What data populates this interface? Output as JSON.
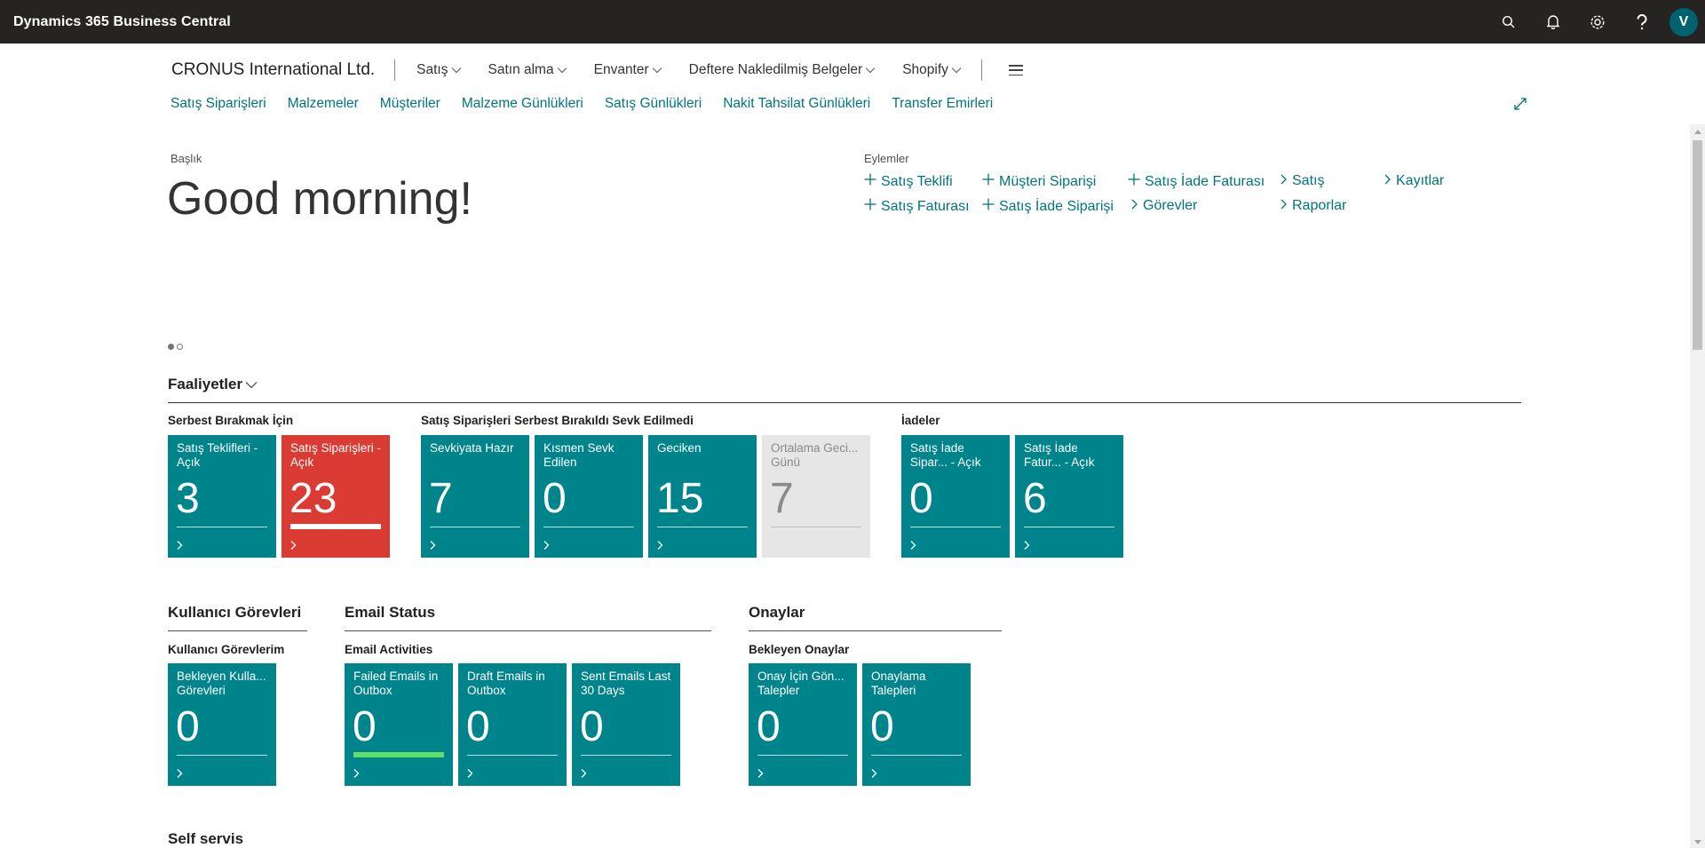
{
  "app": {
    "title": "Dynamics 365 Business Central",
    "user_initial": "V"
  },
  "topbar_icons": [
    "search-icon",
    "bell-icon",
    "gear-icon",
    "help-icon"
  ],
  "nav": {
    "company": "CRONUS International Ltd.",
    "menus": [
      "Satış",
      "Satın alma",
      "Envanter",
      "Deftere Nakledilmiş Belgeler",
      "Shopify"
    ],
    "links": [
      "Satış Siparişleri",
      "Malzemeler",
      "Müşteriler",
      "Malzeme Günlükleri",
      "Satış Günlükleri",
      "Nakit Tahsilat Günlükleri",
      "Transfer Emirleri"
    ]
  },
  "headline": {
    "label": "Başlık",
    "greeting": "Good morning!"
  },
  "actions": {
    "label": "Eylemler",
    "items": [
      {
        "label": "Satış Teklifi",
        "icon": "plus-icon"
      },
      {
        "label": "Satış Faturası",
        "icon": "plus-icon"
      },
      {
        "label": "Müşteri Siparişi",
        "icon": "plus-icon"
      },
      {
        "label": "Satış İade Siparişi",
        "icon": "plus-icon"
      },
      {
        "label": "Satış İade Faturası",
        "icon": "plus-icon"
      },
      {
        "label": "Görevler",
        "icon": "chevron-right-icon"
      },
      {
        "label": "Satış",
        "icon": "chevron-right-icon"
      },
      {
        "label": "Raporlar",
        "icon": "chevron-right-icon"
      },
      {
        "label": "Kayıtlar",
        "icon": "chevron-right-icon"
      }
    ]
  },
  "activities": {
    "title": "Faaliyetler",
    "groups": [
      {
        "title": "Serbest Bırakmak İçin"
      },
      {
        "title": "Satış Siparişleri Serbest Bırakıldı Sevk Edilmedi"
      },
      {
        "title": "İadeler"
      }
    ],
    "tiles": [
      {
        "label": "Satış Teklifleri - Açık",
        "value": "3"
      },
      {
        "label": "Satış Siparişleri - Açık",
        "value": "23"
      },
      {
        "label": "Sevkiyata Hazır",
        "value": "7"
      },
      {
        "label": "Kısmen Sevk Edilen",
        "value": "0"
      },
      {
        "label": "Geciken",
        "value": "15"
      },
      {
        "label": "Ortalama Geci... Günü",
        "value": "7"
      },
      {
        "label": "Satış İade Sipar... - Açık",
        "value": "0"
      },
      {
        "label": "Satış İade Fatur... - Açık",
        "value": "6"
      }
    ]
  },
  "user_tasks": {
    "title": "Kullanıcı Görevleri",
    "group": "Kullanıcı Görevlerim",
    "tiles": [
      {
        "label": "Bekleyen Kulla... Görevleri",
        "value": "0"
      }
    ]
  },
  "email_status": {
    "title": "Email Status",
    "group": "Email Activities",
    "tiles": [
      {
        "label": "Failed Emails in Outbox",
        "value": "0"
      },
      {
        "label": "Draft Emails in Outbox",
        "value": "0"
      },
      {
        "label": "Sent Emails Last 30 Days",
        "value": "0"
      }
    ]
  },
  "approvals": {
    "title": "Onaylar",
    "group": "Bekleyen Onaylar",
    "tiles": [
      {
        "label": "Onay İçin Gön... Talepler",
        "value": "0"
      },
      {
        "label": "Onaylama Talepleri",
        "value": "0"
      }
    ]
  },
  "self_service": {
    "title": "Self servis"
  },
  "colors": {
    "teal": "#00848c",
    "red": "#da3b33",
    "grey": "#e6e6e6",
    "link": "#00757f",
    "appbar": "#252423"
  }
}
